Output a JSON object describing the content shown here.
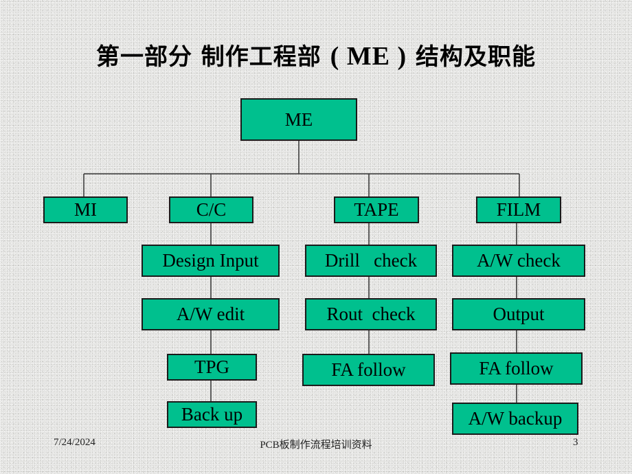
{
  "slide": {
    "title_part1": "第一部分  制作工程部 ",
    "title_latin": "( ME )",
    "title_part2": " 结构及职能"
  },
  "org_chart": {
    "root": "ME",
    "departments": [
      {
        "name": "MI",
        "children": []
      },
      {
        "name": "C/C",
        "children": [
          "Design Input",
          "A/W edit",
          "TPG",
          "Back up"
        ]
      },
      {
        "name": "TAPE",
        "children": [
          "Drill   check",
          "Rout  check",
          "FA follow"
        ]
      },
      {
        "name": "FILM",
        "children": [
          "A/W check",
          "Output",
          "FA follow",
          "A/W backup"
        ]
      }
    ],
    "colors": {
      "box_fill": "#00c08e",
      "box_border": "#1a1a1a",
      "line": "#333333"
    }
  },
  "footer": {
    "date": "7/24/2024",
    "center_text": "PCB板制作流程培训资料",
    "page_number": "3"
  }
}
